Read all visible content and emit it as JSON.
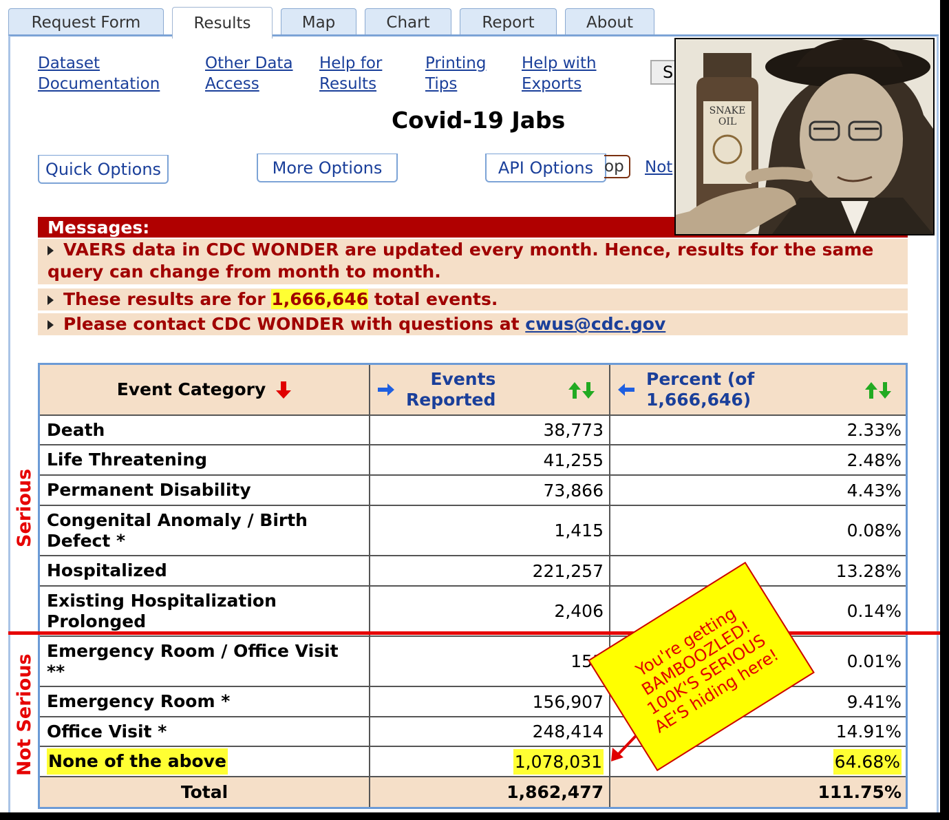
{
  "tabs": [
    "Request Form",
    "Results",
    "Map",
    "Chart",
    "Report",
    "About"
  ],
  "links": {
    "dataset_doc_1": "Dataset",
    "dataset_doc_2": "Documentation",
    "other_access_1": "Other Data",
    "other_access_2": "Access",
    "help_results_1": "Help for",
    "help_results_2": "Results",
    "printing_1": "Printing",
    "printing_2": "Tips",
    "help_exports_1": "Help with",
    "help_exports_2": "Exports",
    "notes_partial": "Not"
  },
  "cutoff_button": "S",
  "small_button": "op",
  "title": "Covid-19 Jabs",
  "options": {
    "quick": "Quick Options",
    "more": "More Options",
    "api": "API Options"
  },
  "messages": {
    "header": "Messages:",
    "m1": "VAERS data in CDC WONDER are updated every month. Hence, results for the same query can change from month to month.",
    "m2_pre": "These results are for ",
    "m2_num": "1,666,646",
    "m2_post": " total events.",
    "m3_pre": "Please contact CDC WONDER with questions at ",
    "m3_email": "cwus@cdc.gov"
  },
  "table": {
    "headers": {
      "category": "Event Category",
      "events_1": "Events",
      "events_2": "Reported",
      "percent_1": "Percent (of",
      "percent_2": "1,666,646)"
    },
    "rows": [
      {
        "category": "Death",
        "events": "38,773",
        "percent": "2.33%"
      },
      {
        "category": "Life Threatening",
        "events": "41,255",
        "percent": "2.48%"
      },
      {
        "category": "Permanent Disability",
        "events": "73,866",
        "percent": "4.43%"
      },
      {
        "category": "Congenital Anomaly / Birth Defect *",
        "events": "1,415",
        "percent": "0.08%"
      },
      {
        "category": "Hospitalized",
        "events": "221,257",
        "percent": "13.28%"
      },
      {
        "category": "Existing Hospitalization Prolonged",
        "events": "2,406",
        "percent": "0.14%"
      },
      {
        "category": "Emergency Room / Office Visit **",
        "events": "153",
        "percent": "0.01%"
      },
      {
        "category": "Emergency Room *",
        "events": "156,907",
        "percent": "9.41%"
      },
      {
        "category": "Office Visit *",
        "events": "248,414",
        "percent": "14.91%"
      },
      {
        "category": "None of the above",
        "events": "1,078,031",
        "percent": "64.68%"
      }
    ],
    "total": {
      "label": "Total",
      "events": "1,862,477",
      "percent": "111.75%"
    }
  },
  "annotations": {
    "serious": "Serious",
    "not_serious": "Not Serious",
    "note": "You're getting BAMBOOZLED! 100K'S SERIOUS AE'S hiding here!",
    "bottle_1": "SNAKE",
    "bottle_2": "OIL"
  },
  "colors": {
    "accent_red": "#e60000",
    "header_bg": "#b00000",
    "row_tint": "#f5dfc8",
    "link": "#1a3f9a",
    "highlight": "#ffff33"
  }
}
